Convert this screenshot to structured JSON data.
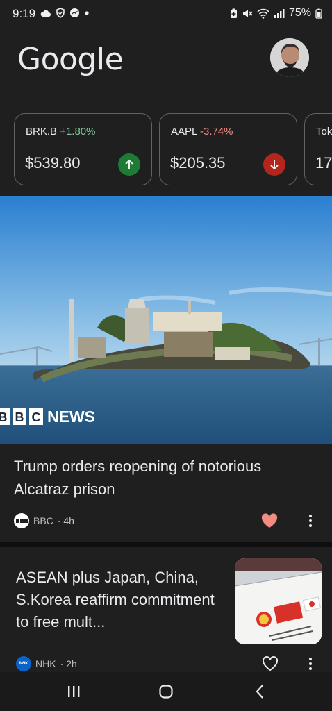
{
  "status_bar": {
    "time": "9:19",
    "battery": "75%",
    "left_icons": [
      "cloud-icon",
      "shield-icon",
      "messenger-icon",
      "dot-icon"
    ],
    "right_icons": [
      "battery-saver-icon",
      "mute-icon",
      "wifi-icon",
      "signal-icon",
      "battery-icon"
    ]
  },
  "header": {
    "logo": "Google"
  },
  "stocks": [
    {
      "ticker": "BRK.B",
      "change": "+1.80%",
      "price": "$539.80",
      "direction": "up"
    },
    {
      "ticker": "AAPL",
      "change": "-3.74%",
      "price": "$205.35",
      "direction": "down"
    },
    {
      "ticker": "Tok",
      "change": "",
      "price": "17",
      "direction": ""
    }
  ],
  "articles": [
    {
      "image_caption": "BBC NEWS",
      "image_logo_letters": [
        "B",
        "B",
        "C"
      ],
      "image_logo_word": "NEWS",
      "headline": "Trump orders reopening of notorious Alcatraz prison",
      "source": "BBC",
      "time": "· 4h",
      "liked": true
    },
    {
      "headline": "ASEAN plus Japan, China, S.Korea reaffirm commitment to free mult...",
      "source": "NHK",
      "source_logo": "NHK",
      "time": "· 2h",
      "liked": false
    }
  ],
  "colors": {
    "background": "#1f1f1f",
    "positive": "#81c995",
    "negative": "#f28b82",
    "up_arrow_bg": "#1e7a34",
    "down_arrow_bg": "#b3261e",
    "heart_liked": "#f28b82"
  },
  "nav": {
    "icons": [
      "recent-apps-icon",
      "home-icon",
      "back-icon"
    ]
  }
}
